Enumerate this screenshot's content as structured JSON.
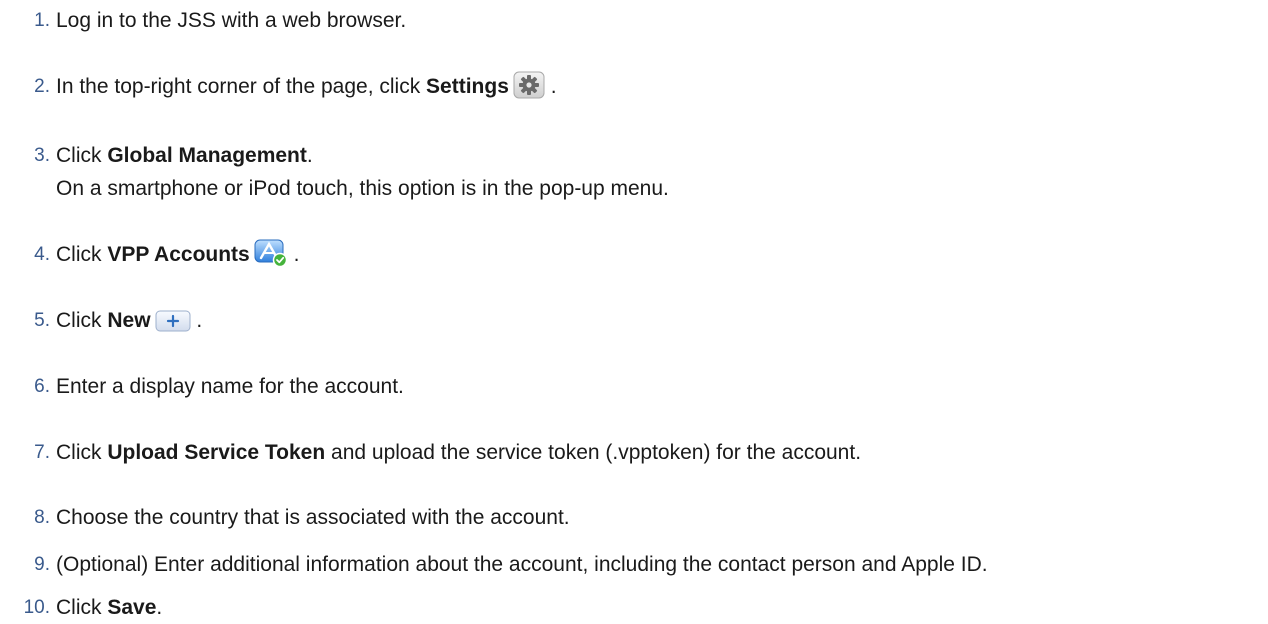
{
  "steps": [
    {
      "num": "1.",
      "text": "Log in to the JSS with a web browser."
    },
    {
      "num": "2.",
      "pre": "In the top-right corner of the page, click ",
      "bold": "Settings",
      "post": " .",
      "icon": "gear-icon"
    },
    {
      "num": "3.",
      "pre": "Click ",
      "bold": "Global Management",
      "post": ".",
      "sub": "On a smartphone or iPod touch, this option is in the pop-up menu."
    },
    {
      "num": "4.",
      "pre": "Click ",
      "bold": "VPP Accounts",
      "post": " .",
      "icon": "vpp-accounts-icon"
    },
    {
      "num": "5.",
      "pre": "Click ",
      "bold": "New",
      "post": " .",
      "icon": "plus-button-icon"
    },
    {
      "num": "6.",
      "text": "Enter a display name for the account."
    },
    {
      "num": "7.",
      "pre": "Click ",
      "bold": "Upload Service Token",
      "post": " and upload the service token (.vpptoken) for the account."
    },
    {
      "num": "8.",
      "text": "Choose the country that is associated with the account."
    },
    {
      "num": "9.",
      "text": "(Optional) Enter additional information about the account, including the contact person and Apple ID."
    },
    {
      "num": "10.",
      "pre": "Click ",
      "bold": "Save",
      "post": "."
    }
  ]
}
